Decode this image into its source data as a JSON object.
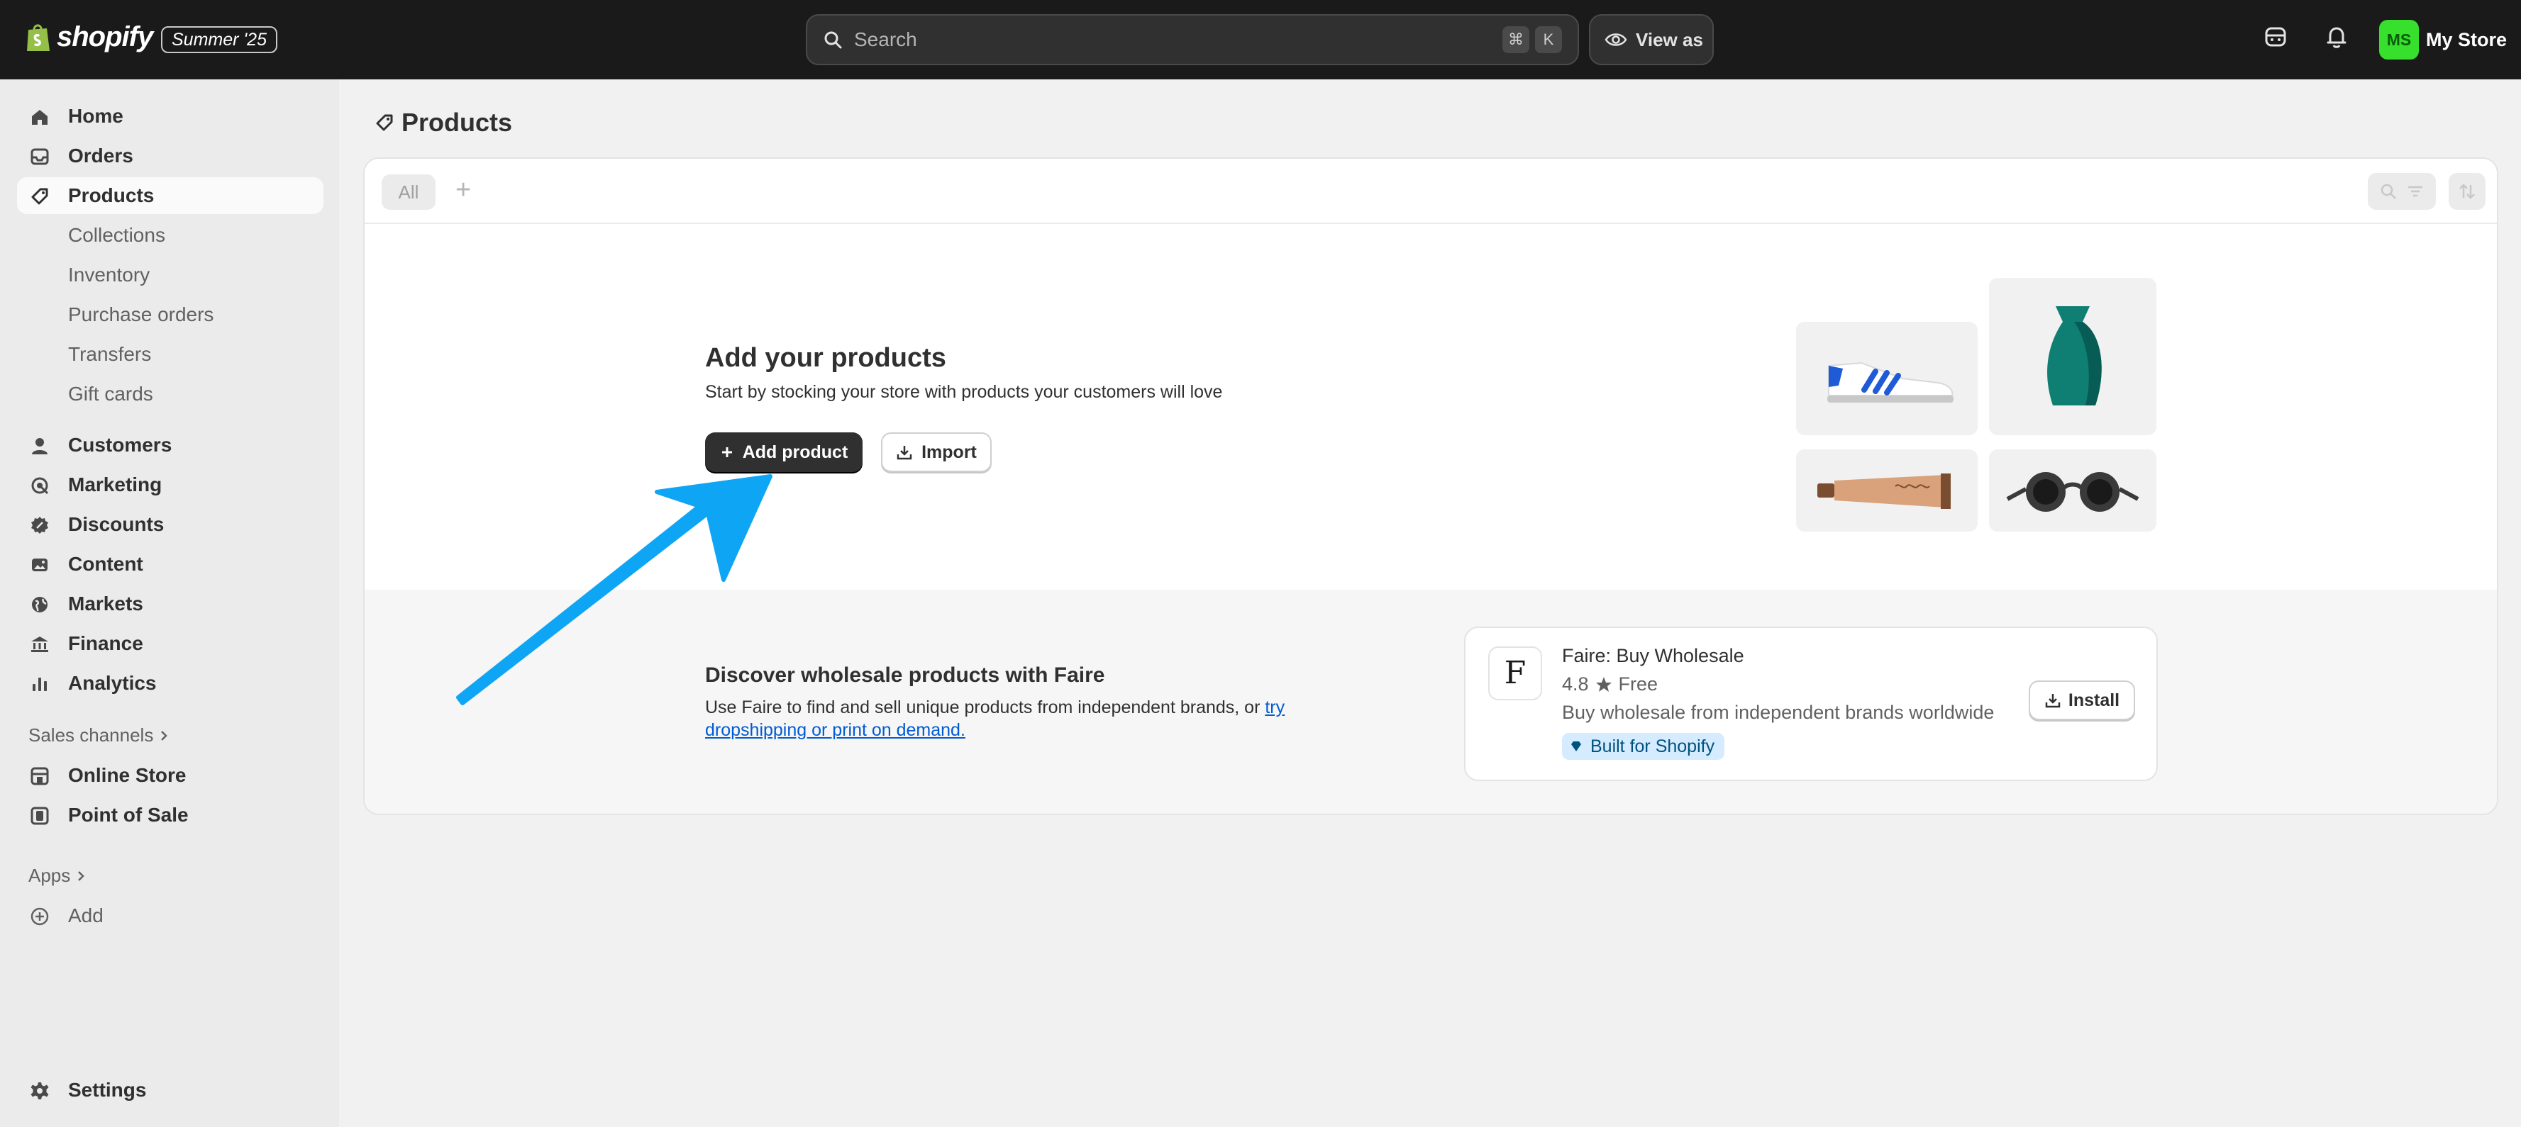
{
  "topbar": {
    "brand": "shopify",
    "edition_badge": "Summer '25",
    "search_placeholder": "Search",
    "shortcut_keys": [
      "⌘",
      "K"
    ],
    "view_as_label": "View as",
    "store_initials": "MS",
    "store_name": "My Store",
    "accent_color": "#36e02c"
  },
  "sidebar": {
    "main_items": [
      {
        "label": "Home",
        "icon": "home-icon"
      },
      {
        "label": "Orders",
        "icon": "inbox-icon"
      },
      {
        "label": "Products",
        "icon": "tag-icon",
        "active": true
      }
    ],
    "product_subitems": [
      "Collections",
      "Inventory",
      "Purchase orders",
      "Transfers",
      "Gift cards"
    ],
    "more_items": [
      {
        "label": "Customers",
        "icon": "person-icon"
      },
      {
        "label": "Marketing",
        "icon": "target-icon"
      },
      {
        "label": "Discounts",
        "icon": "discount-icon"
      },
      {
        "label": "Content",
        "icon": "image-icon"
      },
      {
        "label": "Markets",
        "icon": "globe-icon"
      },
      {
        "label": "Finance",
        "icon": "bank-icon"
      },
      {
        "label": "Analytics",
        "icon": "bar-chart-icon"
      }
    ],
    "sales_channels_label": "Sales channels",
    "channels": [
      {
        "label": "Online Store",
        "icon": "store-icon"
      },
      {
        "label": "Point of Sale",
        "icon": "pos-icon"
      }
    ],
    "apps_label": "Apps",
    "add_label": "Add",
    "settings_label": "Settings"
  },
  "page": {
    "title": "Products",
    "tab_all": "All",
    "tab_add": "+"
  },
  "empty_state": {
    "title": "Add your products",
    "subtitle": "Start by stocking your store with products your customers will love",
    "add_button": "Add product",
    "import_button": "Import"
  },
  "wholesale": {
    "title": "Discover wholesale products with Faire",
    "text": "Use Faire to find and sell unique products from independent brands, or ",
    "link_text": "try dropshipping or print on demand.",
    "app": {
      "logo_letter": "F",
      "name": "Faire: Buy Wholesale",
      "rating": "4.8",
      "price": "Free",
      "description": "Buy wholesale from independent brands worldwide",
      "badge": "Built for Shopify",
      "install_label": "Install"
    }
  },
  "annotation_color": "#0ea5f5"
}
